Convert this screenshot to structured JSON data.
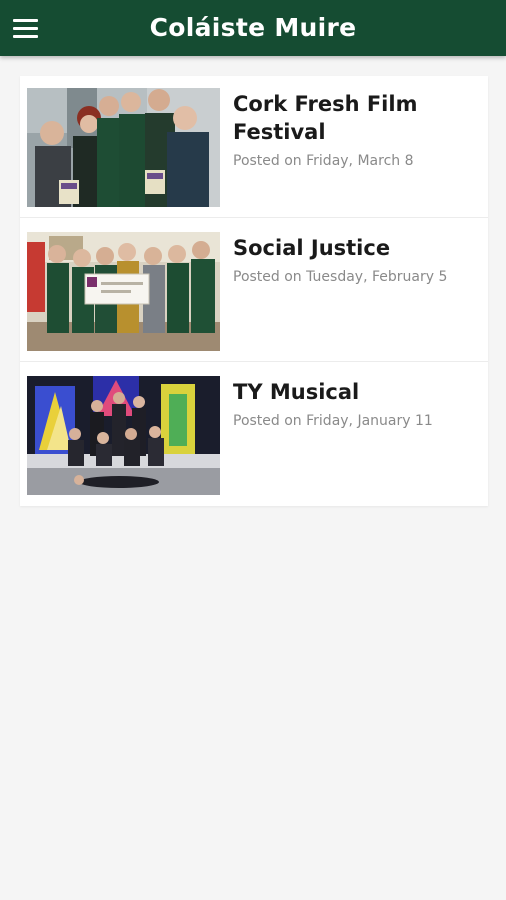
{
  "app": {
    "title": "Coláiste Muire",
    "menu_icon": "hamburger-menu-icon"
  },
  "colors": {
    "appbar": "#154c32",
    "background": "#f5f5f5",
    "card": "#ffffff",
    "title_text": "#1a1a1a",
    "date_text": "#8a8a8a"
  },
  "posts": [
    {
      "title": "Cork Fresh Film Festival",
      "date": "Posted on Friday, March 8"
    },
    {
      "title": "Social Justice",
      "date": "Posted on Tuesday, February 5"
    },
    {
      "title": "TY Musical",
      "date": "Posted on Friday, January 11"
    }
  ]
}
